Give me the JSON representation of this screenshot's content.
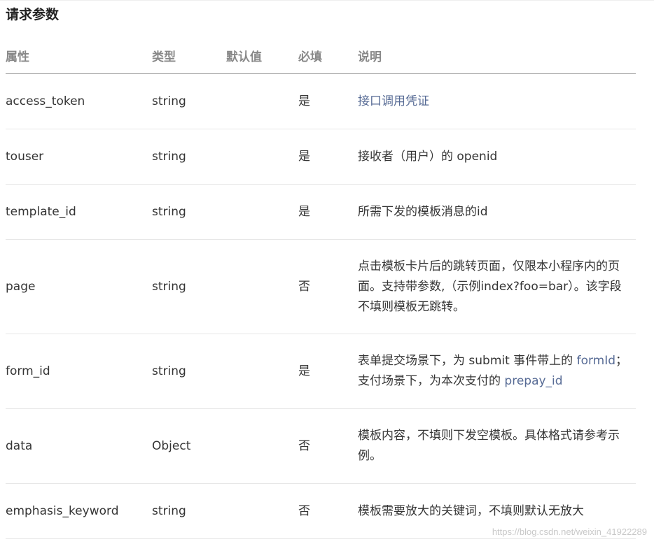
{
  "section": {
    "title": "请求参数"
  },
  "table": {
    "headers": {
      "name": "属性",
      "type": "类型",
      "default": "默认值",
      "required": "必填",
      "description": "说明"
    },
    "rows": [
      {
        "name": "access_token",
        "type": "string",
        "default": "",
        "required": "是",
        "description": "接口调用凭证"
      },
      {
        "name": "touser",
        "type": "string",
        "default": "",
        "required": "是",
        "description": "接收者（用户）的 openid"
      },
      {
        "name": "template_id",
        "type": "string",
        "default": "",
        "required": "是",
        "description": "所需下发的模板消息的id"
      },
      {
        "name": "page",
        "type": "string",
        "default": "",
        "required": "否",
        "description": "点击模板卡片后的跳转页面，仅限本小程序内的页面。支持带参数,（示例index?foo=bar）。该字段不填则模板无跳转。"
      },
      {
        "name": "form_id",
        "type": "string",
        "default": "",
        "required": "是",
        "description_parts": {
          "a": "表单提交场景下，为 submit 事件带上的 ",
          "a_link": "formId",
          "b": "；支付场景下，为本次支付的 ",
          "b_link": "prepay_id"
        }
      },
      {
        "name": "data",
        "type": "Object",
        "default": "",
        "required": "否",
        "description": "模板内容，不填则下发空模板。具体格式请参考示例。"
      },
      {
        "name": "emphasis_keyword",
        "type": "string",
        "default": "",
        "required": "否",
        "description": "模板需要放大的关键词，不填则默认无放大"
      }
    ]
  },
  "watermark": "https://blog.csdn.net/weixin_41922289",
  "colors": {
    "link": "#576b95",
    "header_text": "#888888",
    "body_text": "#353535"
  }
}
